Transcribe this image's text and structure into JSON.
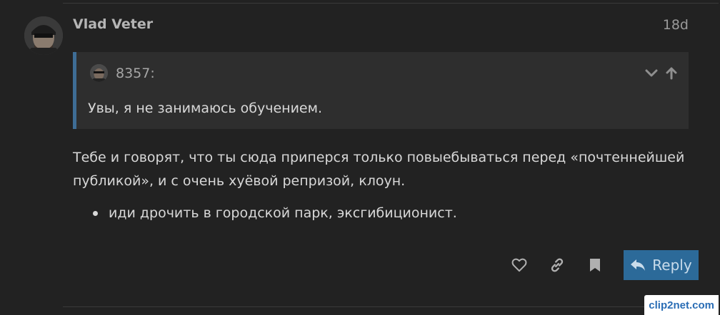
{
  "post": {
    "username": "Vlad Veter",
    "date": "18d",
    "avatar_icon": "user-avatar",
    "quote": {
      "author": "8357:",
      "text": "Увы, я не занимаюсь обучением.",
      "collapse_icon": "chevron-down-icon",
      "goto_icon": "arrow-up-icon",
      "border_color": "#3e6d96"
    },
    "body": "Тебе и говорят, что ты сюда приперся только повыебываться перед «почтеннейшей публикой», и с очень хуёвой репризой, клоун.",
    "list_items": [
      "иди дрочить в городской парк, эксгибиционист."
    ]
  },
  "actions": {
    "like_icon": "heart-icon",
    "share_icon": "link-icon",
    "bookmark_icon": "bookmark-icon",
    "reply_icon": "reply-arrow-icon",
    "reply_label": "Reply",
    "reply_color": "#2c6a99"
  },
  "watermark": {
    "text": "clip2net.com"
  }
}
